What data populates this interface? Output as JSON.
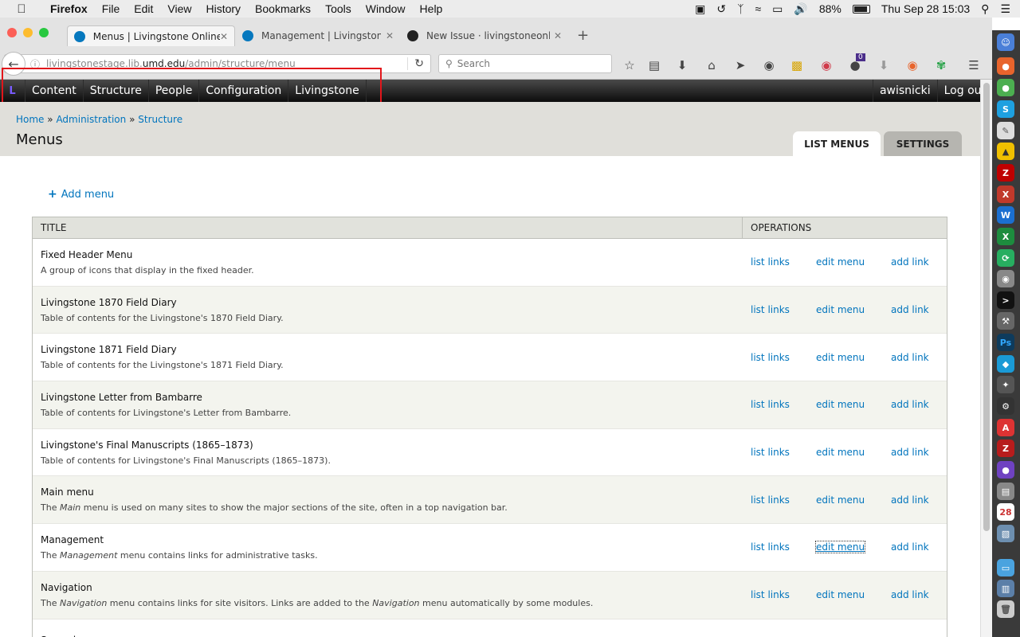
{
  "mac_menu": {
    "app": "Firefox",
    "items": [
      "File",
      "Edit",
      "View",
      "History",
      "Bookmarks",
      "Tools",
      "Window",
      "Help"
    ],
    "battery": "88%",
    "battery_level": 0.88,
    "clock": "Thu Sep 28  15:03"
  },
  "browser": {
    "tabs": [
      {
        "title": "Menus | Livingstone Online",
        "active": true
      },
      {
        "title": "Management | Livingstone On",
        "active": false
      },
      {
        "title": "New Issue · livingstoneonline/",
        "active": false
      }
    ],
    "url_prefix": "livingstonestage.lib.",
    "url_domain": "umd.edu",
    "url_path": "/admin/structure/menu",
    "search_placeholder": "Search",
    "pocket_badge": "0"
  },
  "toolbar": {
    "items": [
      "Content",
      "Structure",
      "People",
      "Configuration",
      "Livingstone"
    ],
    "user": "awisnicki",
    "logout": "Log out"
  },
  "breadcrumb": [
    "Home",
    "Administration",
    "Structure"
  ],
  "breadcrumb_sep": "»",
  "page_title": "Menus",
  "page_tabs": {
    "list": "LIST MENUS",
    "settings": "SETTINGS"
  },
  "add_menu": "Add menu",
  "table": {
    "headers": [
      "TITLE",
      "OPERATIONS"
    ],
    "operations": [
      "list links",
      "edit menu",
      "add link"
    ],
    "rows": [
      {
        "title": "Fixed Header Menu",
        "desc": "A group of icons that display in the fixed header."
      },
      {
        "title": "Livingstone 1870 Field Diary",
        "desc": "Table of contents for the Livingstone's 1870 Field Diary."
      },
      {
        "title": "Livingstone 1871 Field Diary",
        "desc": "Table of contents for the Livingstone's 1871 Field Diary."
      },
      {
        "title": "Livingstone Letter from Bambarre",
        "desc": "Table of contents for Livingstone's Letter from Bambarre."
      },
      {
        "title": "Livingstone's Final Manuscripts (1865–1873)",
        "desc": "Table of contents for Livingstone's Final Manuscripts (1865–1873)."
      },
      {
        "title": "Main menu",
        "desc_pre": "The ",
        "desc_em": "Main",
        "desc_post": " menu is used on many sites to show the major sections of the site, often in a top navigation bar."
      },
      {
        "title": "Management",
        "desc_pre": "The ",
        "desc_em": "Management",
        "desc_post": " menu contains links for administrative tasks."
      },
      {
        "title": "Navigation",
        "desc_pre": "The ",
        "desc_em": "Navigation",
        "desc_post": " menu contains links for site visitors. Links are added to the ",
        "desc_em2": "Navigation",
        "desc_post2": " menu automatically by some modules."
      },
      {
        "title": "Secondary menu",
        "desc": ""
      }
    ]
  },
  "colors": {
    "link": "#0074bd",
    "header_bg": "#e0dfda",
    "toolbar_bg": "#0c0c0c",
    "annotation": "#e2161b"
  }
}
